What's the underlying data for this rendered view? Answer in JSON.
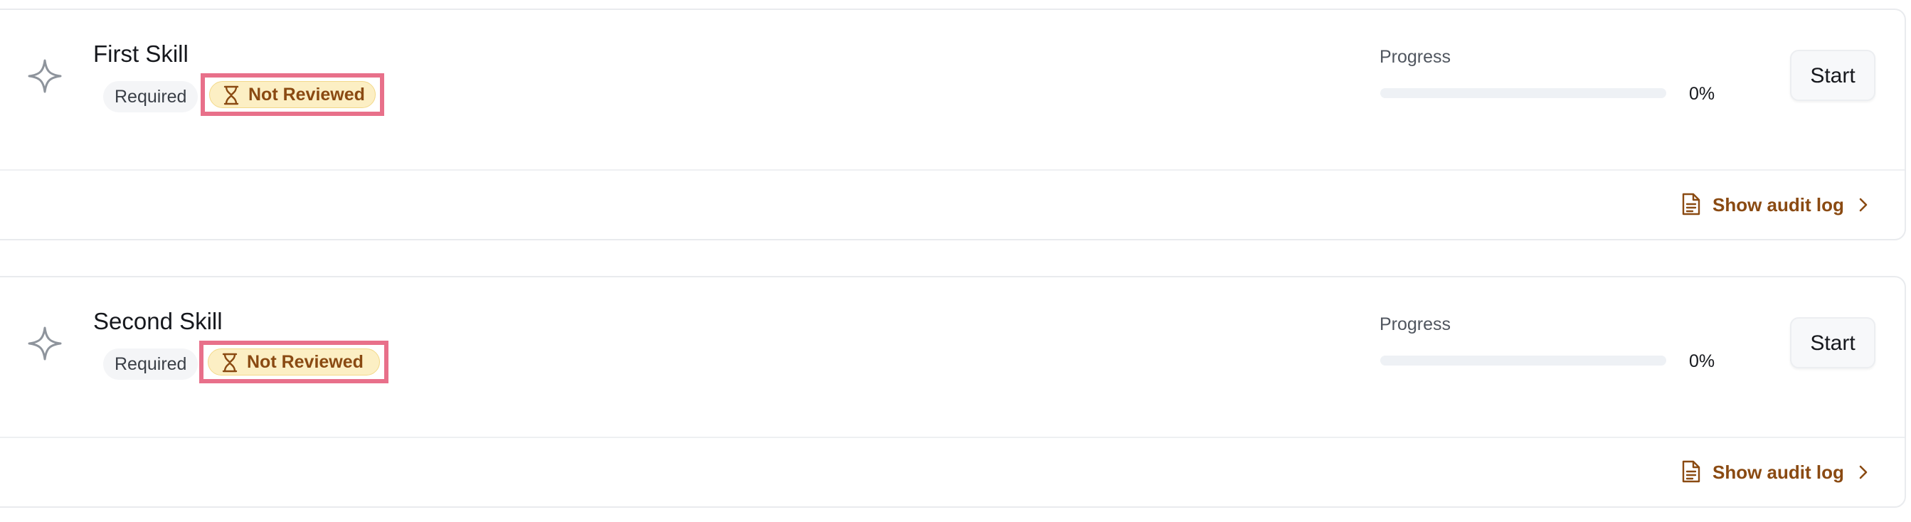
{
  "skills": [
    {
      "title": "First Skill",
      "required_label": "Required",
      "status_label": "Not Reviewed",
      "progress_label": "Progress",
      "progress_value": "0%",
      "progress_fraction": 0,
      "start_label": "Start",
      "audit_label": "Show audit log"
    },
    {
      "title": "Second Skill",
      "required_label": "Required",
      "status_label": "Not Reviewed",
      "progress_label": "Progress",
      "progress_value": "0%",
      "progress_fraction": 0,
      "start_label": "Start",
      "audit_label": "Show audit log"
    }
  ],
  "icons": {
    "skill": "sparkle-icon",
    "status": "hourglass-icon",
    "audit": "document-icon",
    "audit_arrow": "chevron-right-icon"
  },
  "colors": {
    "accent": "#8a4a12",
    "status_bg": "#fcefc4",
    "highlight": "#e8708a",
    "icon_gray": "#8e949c"
  }
}
